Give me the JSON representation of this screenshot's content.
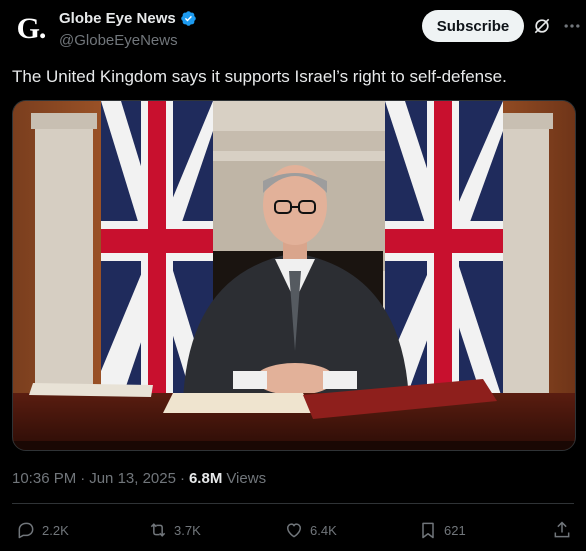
{
  "account": {
    "avatar_letter": "G.",
    "display_name": "Globe Eye News",
    "handle": "@GlobeEyeNews",
    "verified_color": "#1d9bf0"
  },
  "header": {
    "subscribe_label": "Subscribe",
    "icons": [
      "grok-icon",
      "more-icon"
    ]
  },
  "tweet": {
    "text": "The United Kingdom says it supports Israel’s right to self-defense."
  },
  "meta": {
    "time": "10:36 PM",
    "date": "Jun 13, 2025",
    "views_count": "6.8M",
    "views_label": "Views"
  },
  "actions": {
    "replies": "2.2K",
    "reposts": "3.7K",
    "likes": "6.4K",
    "bookmarks": "621"
  },
  "colors": {
    "background": "#000000",
    "text": "#e7e9ea",
    "muted": "#71767b",
    "divider": "#2f3336"
  }
}
